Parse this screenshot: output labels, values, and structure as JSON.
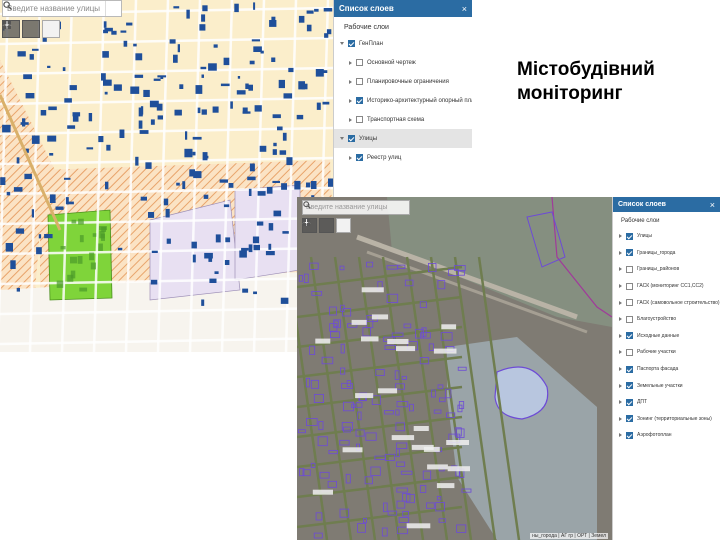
{
  "title": {
    "line1": "Містобудівний",
    "line2": "моніторинг"
  },
  "screenshot1": {
    "search": {
      "placeholder": "Введите название улицы"
    },
    "panel": {
      "header": "Список слоев",
      "close_glyph": "×",
      "section": "Рабочие слои",
      "layers": [
        {
          "label": "ГенПлан",
          "checked": true,
          "expanded": true,
          "level": 0,
          "selected": false
        },
        {
          "label": "Основной чертеж",
          "checked": false,
          "expanded": false,
          "level": 1,
          "selected": false
        },
        {
          "label": "Планировочные ограничения",
          "checked": false,
          "expanded": false,
          "level": 1,
          "selected": false
        },
        {
          "label": "Историко-архитектурный опорный план",
          "checked": true,
          "expanded": false,
          "level": 1,
          "selected": false
        },
        {
          "label": "Транспортная схема",
          "checked": false,
          "expanded": false,
          "level": 1,
          "selected": false
        },
        {
          "label": "Улицы",
          "checked": true,
          "expanded": true,
          "level": 0,
          "selected": true
        },
        {
          "label": "Реестр улиц",
          "checked": true,
          "expanded": false,
          "level": 1,
          "selected": false
        }
      ]
    },
    "colors": {
      "panel_header": "#2b6ca3",
      "map_bg": "#fbeecb",
      "buildings": "#1f4f9a",
      "green_zone": "#7fd43a",
      "hatch": "#e8a36a",
      "lilac": "#e8e0f2"
    }
  },
  "screenshot2": {
    "search": {
      "placeholder": "Введите название улицы"
    },
    "panel": {
      "header": "Список слоев",
      "close_glyph": "×",
      "section": "Рабочие слои",
      "layers": [
        {
          "label": "Улицы",
          "checked": true
        },
        {
          "label": "Границы_города",
          "checked": true
        },
        {
          "label": "Границы_районов",
          "checked": false
        },
        {
          "label": "ГАСК (мониторинг СС1,СС2)",
          "checked": false
        },
        {
          "label": "ГАСК (самовольное строительство)",
          "checked": false
        },
        {
          "label": "Благоустройство",
          "checked": false
        },
        {
          "label": "Исходные данные",
          "checked": true
        },
        {
          "label": "Рабочие участки",
          "checked": false
        },
        {
          "label": "Паспорта фасада",
          "checked": true
        },
        {
          "label": "Земельные участки",
          "checked": true
        },
        {
          "label": "ДПТ",
          "checked": true
        },
        {
          "label": "Зонинг (территориальные зоны)",
          "checked": true
        },
        {
          "label": "Аэрофотоплан",
          "checked": true
        }
      ]
    },
    "attribution": "ны_города | АГ гр | ОРТ | Земел",
    "colors": {
      "parcels": "#6d4bd6",
      "water": "#b8c6df",
      "satellite": "#8d8f86"
    }
  }
}
